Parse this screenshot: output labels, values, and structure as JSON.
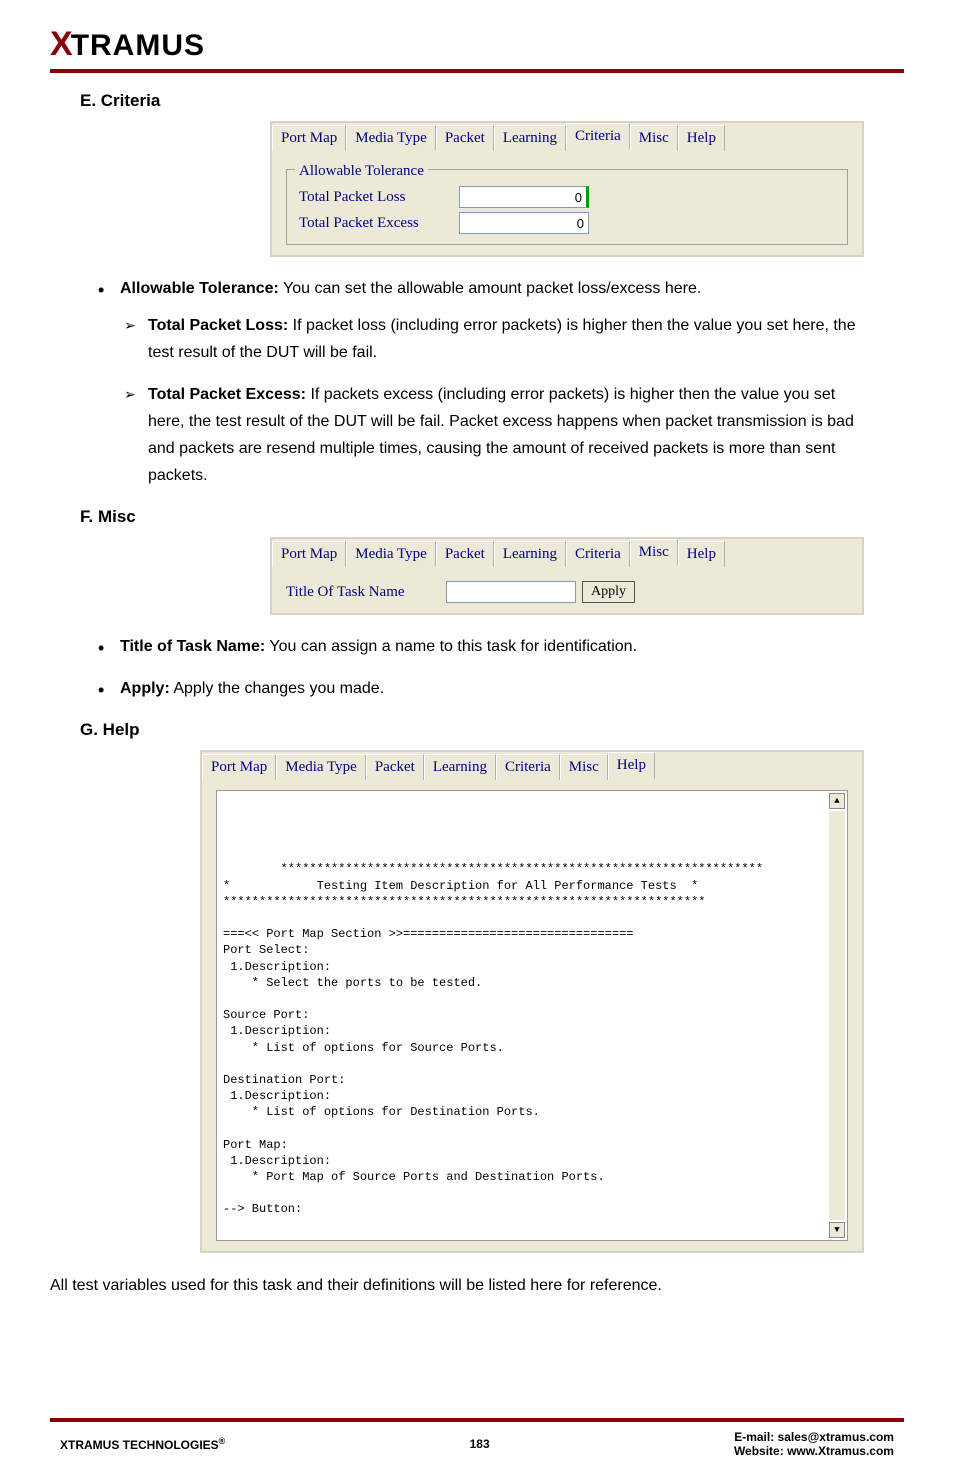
{
  "logo": {
    "letter": "X",
    "rest": "TRAMUS"
  },
  "tabs": [
    "Port Map",
    "Media Type",
    "Packet",
    "Learning",
    "Criteria",
    "Misc",
    "Help"
  ],
  "sectionE": {
    "heading": "E. Criteria",
    "legend": "Allowable Tolerance",
    "row1_label": "Total Packet Loss",
    "row1_value": "0",
    "row2_label": "Total Packet Excess",
    "row2_value": "0"
  },
  "criteriaBullets": {
    "main": "Allowable Tolerance:",
    "main_text": " You can set the allowable amount packet loss/excess here.",
    "sub1_bold": "Total Packet Loss:",
    "sub1_text": " If packet loss (including error packets) is higher then the value you set here, the test result of the DUT will be fail.",
    "sub2_bold": "Total Packet Excess:",
    "sub2_text": " If packets excess (including error packets) is higher then the value you set here, the test result of the DUT will be fail. Packet excess happens when packet transmission is bad and packets are resend multiple times, causing the amount of received packets is more than sent packets."
  },
  "sectionF": {
    "heading": "F. Misc",
    "label": "Title Of Task Name",
    "value": "",
    "button": "Apply"
  },
  "miscBullets": {
    "b1_bold": "Title of Task Name:",
    "b1_text": " You can assign a name to this task for identification.",
    "b2_bold": "Apply:",
    "b2_text": " Apply the changes you made."
  },
  "sectionG": {
    "heading": "G. Help",
    "help_text": "*******************************************************************\n*            Testing Item Description for All Performance Tests  *\n*******************************************************************\n\n===<< Port Map Section >>================================\nPort Select:\n 1.Description:\n    * Select the ports to be tested.\n\nSource Port:\n 1.Description:\n    * List of options for Source Ports.\n\nDestination Port:\n 1.Description:\n    * List of options for Destination Ports.\n\nPort Map:\n 1.Description:\n    * Port Map of Source Ports and Destination Ports.\n\n--> Button:"
  },
  "afterHelpText": "All test variables used for this task and their definitions will be listed here for reference.",
  "footer": {
    "left": "XTRAMUS TECHNOLOGIES",
    "reg": "®",
    "page": "183",
    "email_label": "E-mail: ",
    "email": "sales@xtramus.com",
    "web_label": "Website:  ",
    "web": "www.Xtramus.com"
  }
}
